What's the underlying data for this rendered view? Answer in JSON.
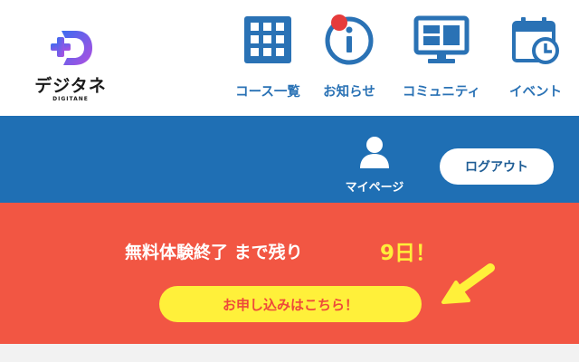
{
  "logo": {
    "name": "デジタネ",
    "sub": "DIGITANE"
  },
  "nav": {
    "courses_label": "コース一覧",
    "news_label": "お知らせ",
    "community_label": "コミュニティ",
    "events_label": "イベント"
  },
  "account": {
    "mypage_label": "マイページ",
    "logout_label": "ログアウト"
  },
  "trial": {
    "message": "無料体験終了 まで残り",
    "days": "9日！",
    "apply_label": "お申し込みはこちら！"
  },
  "colors": {
    "accent_blue": "#1f6fb4",
    "nav_blue": "#2a72b5",
    "banner_red": "#f25643",
    "highlight_yellow": "#fff03a",
    "notification_red": "#e63b3b"
  }
}
